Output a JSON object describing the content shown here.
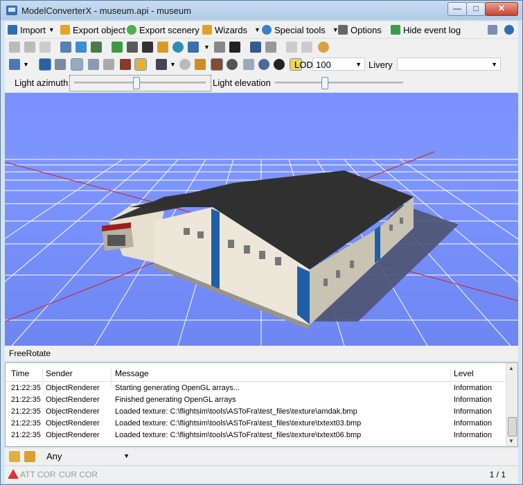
{
  "window": {
    "title": "ModelConverterX - museum.api - museum",
    "min_glyph": "—",
    "max_glyph": "□",
    "close_glyph": "✕"
  },
  "menu": {
    "import": "Import",
    "export_object": "Export object",
    "export_scenery": "Export scenery",
    "wizards": "Wizards",
    "special_tools": "Special tools",
    "options": "Options",
    "hide_event_log": "Hide event log"
  },
  "toolbar3": {
    "lod_label": "LOD",
    "lod_value": "100",
    "livery_label": "Livery",
    "livery_value": ""
  },
  "lighting": {
    "azimuth_label": "Light azimuth",
    "azimuth_level": 0.47,
    "elevation_label": "Light elevation",
    "elevation_level": 0.38
  },
  "viewport_mode": "FreeRotate",
  "log": {
    "columns": [
      "Time",
      "Sender",
      "Message",
      "Level"
    ],
    "rows": [
      {
        "time": "21:22:35",
        "sender": "ObjectRenderer",
        "message": "Starting generating OpenGL arrays...",
        "level": "Information"
      },
      {
        "time": "21:22:35",
        "sender": "ObjectRenderer",
        "message": "Finished generating OpenGL arrays",
        "level": "Information"
      },
      {
        "time": "21:22:35",
        "sender": "ObjectRenderer",
        "message": "Loaded texture: C:\\flightsim\\tools\\ASToFra\\test_files\\texture\\amdak.bmp",
        "level": "Information"
      },
      {
        "time": "21:22:35",
        "sender": "ObjectRenderer",
        "message": "Loaded texture: C:\\flightsim\\tools\\ASToFra\\test_files\\texture\\txtext03.bmp",
        "level": "Information"
      },
      {
        "time": "21:22:35",
        "sender": "ObjectRenderer",
        "message": "Loaded texture: C:\\flightsim\\tools\\ASToFra\\test_files\\texture\\txtext06.bmp",
        "level": "Information"
      }
    ]
  },
  "filter": {
    "value": "Any"
  },
  "status": {
    "att_cor": "ATT COR",
    "cur_cor": "CUR COR",
    "page": "1 / 1"
  },
  "colors": {
    "sky": "#7b90ff",
    "grid": "#ffffff",
    "axis": "#cc1f1f",
    "roof": "#2e2e2e",
    "wall": "#ece7d8",
    "accent": "#1f5fa8"
  }
}
